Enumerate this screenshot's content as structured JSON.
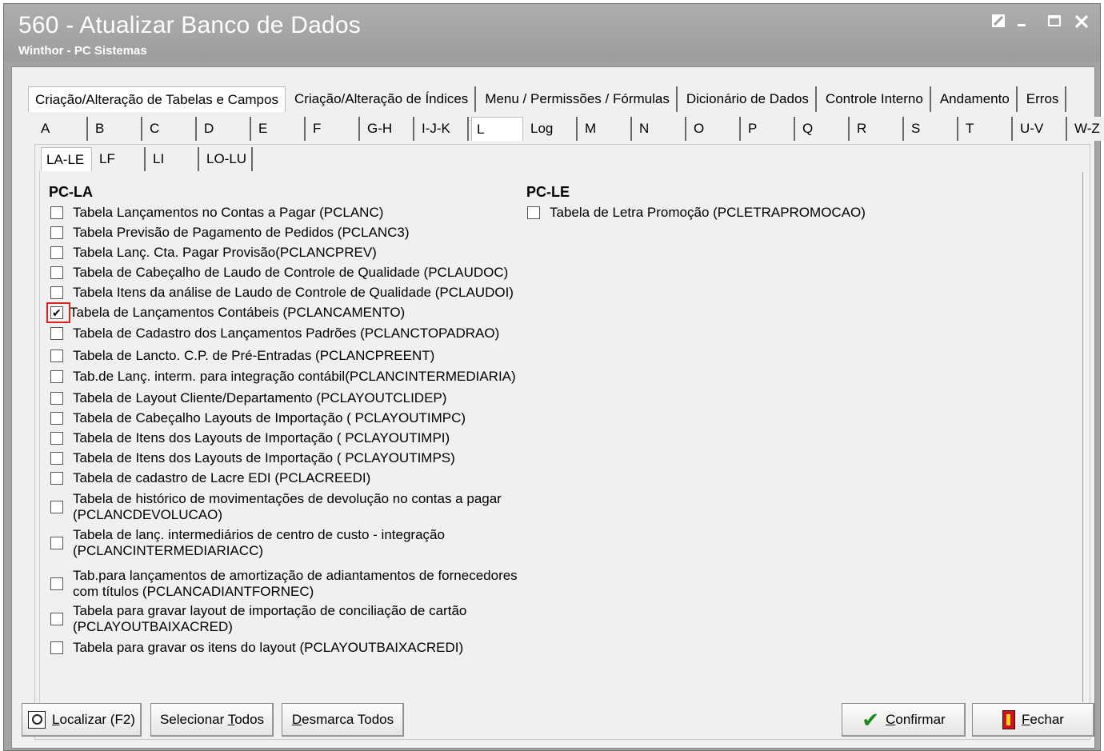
{
  "window": {
    "title": "560 - Atualizar Banco de Dados",
    "subtitle": "Winthor - PC Sistemas",
    "controls": [
      "restore-icon",
      "minimize-icon",
      "maximize-icon",
      "close-icon"
    ]
  },
  "tabs_main": [
    {
      "label": "Criação/Alteração de Tabelas e Campos",
      "active": true
    },
    {
      "label": "Criação/Alteração de Índices",
      "active": false
    },
    {
      "label": "Menu / Permissões / Fórmulas",
      "active": false
    },
    {
      "label": "Dicionário de Dados",
      "active": false
    },
    {
      "label": "Controle Interno",
      "active": false
    },
    {
      "label": "Andamento",
      "active": false
    },
    {
      "label": "Erros",
      "active": false
    }
  ],
  "tabs_letters": [
    "A",
    "B",
    "C",
    "D",
    "E",
    "F",
    "G-H",
    "I-J-K",
    "L",
    "Log",
    "M",
    "N",
    "O",
    "P",
    "Q",
    "R",
    "S",
    "T",
    "U-V",
    "W-Z"
  ],
  "tabs_letters_active": "L",
  "tabs_sub": [
    "LA-LE",
    "LF",
    "LI",
    "LO-LU"
  ],
  "tabs_sub_active": "LA-LE",
  "group_la": {
    "header": "PC-LA",
    "items": [
      {
        "label": "Tabela Lançamentos no Contas a Pagar (PCLANC)",
        "checked": false
      },
      {
        "label": "Tabela Previsão de Pagamento de Pedidos (PCLANC3)",
        "checked": false
      },
      {
        "label": "Tabela Lanç. Cta. Pagar Provisão(PCLANCPREV)",
        "checked": false
      },
      {
        "label": "Tabela de Cabeçalho de Laudo de Controle de Qualidade (PCLAUDOC)",
        "checked": false
      },
      {
        "label": "Tabela Itens da análise de Laudo de Controle de Qualidade (PCLAUDOI)",
        "checked": false
      },
      {
        "label": "Tabela de Lançamentos Contábeis (PCLANCAMENTO)",
        "checked": true
      },
      {
        "label": "Tabela de Cadastro dos Lançamentos Padrões (PCLANCTOPADRAO)",
        "checked": false
      },
      {
        "label": "Tabela de Lancto. C.P. de Pré-Entradas (PCLANCPREENT)",
        "checked": false
      },
      {
        "label": "Tab.de Lanç. interm. para integração contábil(PCLANCINTERMEDIARIA)",
        "checked": false
      },
      {
        "label": "Tabela de Layout Cliente/Departamento (PCLAYOUTCLIDEP)",
        "checked": false
      },
      {
        "label": "Tabela de Cabeçalho Layouts de Importação ( PCLAYOUTIMPC)",
        "checked": false
      },
      {
        "label": "Tabela de Itens dos Layouts de Importação ( PCLAYOUTIMPI)",
        "checked": false
      },
      {
        "label": "Tabela de Itens dos Layouts de Importação ( PCLAYOUTIMPS)",
        "checked": false
      },
      {
        "label": "Tabela de cadastro de Lacre EDI (PCLACREEDI)",
        "checked": false
      },
      {
        "label": "Tabela de histórico de movimentações de devolução no contas a pagar",
        "label2": "(PCLANCDEVOLUCAO)",
        "checked": false
      },
      {
        "label": "Tabela de lanç.  intermediários de centro de custo - integração",
        "label2": "(PCLANCINTERMEDIARIACC)",
        "checked": false
      },
      {
        "label": "Tab.para lançamentos de amortização de adiantamentos de fornecedores",
        "label2": "com títulos (PCLANCADIANTFORNEC)",
        "checked": false
      },
      {
        "label": "Tabela para gravar layout de importação de conciliação de cartão",
        "label2": "(PCLAYOUTBAIXACRED)",
        "checked": false
      },
      {
        "label": "Tabela para gravar os itens do layout (PCLAYOUTBAIXACREDI)",
        "checked": false
      }
    ]
  },
  "group_le": {
    "header": "PC-LE",
    "items": [
      {
        "label": "Tabela de Letra Promoção (PCLETRAPROMOCAO)",
        "checked": false
      }
    ]
  },
  "buttons": {
    "localizar": "ocalizar (F2)",
    "localizar_mnemonic": "L",
    "selecionar_pre": "Selecionar ",
    "selecionar_mnemonic": "T",
    "selecionar_post": "odos",
    "desmarca_mnemonic": "D",
    "desmarca_post": "esmarca Todos",
    "confirmar_mnemonic": "C",
    "confirmar_post": "onfirmar",
    "fechar_mnemonic": "F",
    "fechar_post": "echar"
  }
}
